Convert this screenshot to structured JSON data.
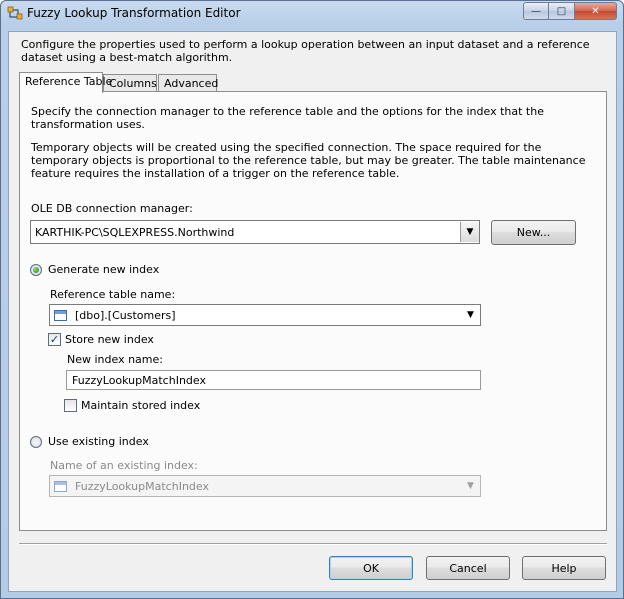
{
  "window": {
    "title": "Fuzzy Lookup Transformation Editor",
    "icon": "ssis-transform-icon",
    "minimize_glyph": "—",
    "maximize_glyph": "□",
    "close_glyph": "✕"
  },
  "description": "Configure the properties used to perform a lookup operation between an input dataset and a reference dataset using a best-match algorithm.",
  "tabs": [
    {
      "label": "Reference Table",
      "active": true
    },
    {
      "label": "Columns",
      "active": false
    },
    {
      "label": "Advanced",
      "active": false
    }
  ],
  "panel": {
    "intro": "Specify the connection manager to the reference table and the options for the index that the transformation uses.",
    "temp_note": "Temporary objects will be created using the specified connection. The space required for the temporary objects is proportional to the reference table, but may be greater. The table maintenance feature requires the installation of a trigger on the reference table.",
    "connection_label": "OLE DB connection manager:",
    "connection_value": "KARTHIK-PC\\SQLEXPRESS.Northwind",
    "new_button": "New...",
    "generate_label": "Generate new index",
    "generate_selected": true,
    "reference_table_label": "Reference table name:",
    "reference_table_value": "[dbo].[Customers]",
    "store_label": "Store new index",
    "store_checked": true,
    "new_index_label": "New index name:",
    "new_index_value": "FuzzyLookupMatchIndex",
    "maintain_label": "Maintain stored index",
    "maintain_checked": false,
    "use_existing_label": "Use existing index",
    "use_existing_selected": false,
    "existing_index_label": "Name of an existing index:",
    "existing_index_value": "FuzzyLookupMatchIndex"
  },
  "footer": {
    "ok": "OK",
    "cancel": "Cancel",
    "help": "Help"
  },
  "colors": {
    "title_gradient_top": "#c9dbef",
    "close_button": "#c44a31",
    "default_button_border": "#3c7fb1",
    "radio_selected": "#1c7b1c"
  }
}
